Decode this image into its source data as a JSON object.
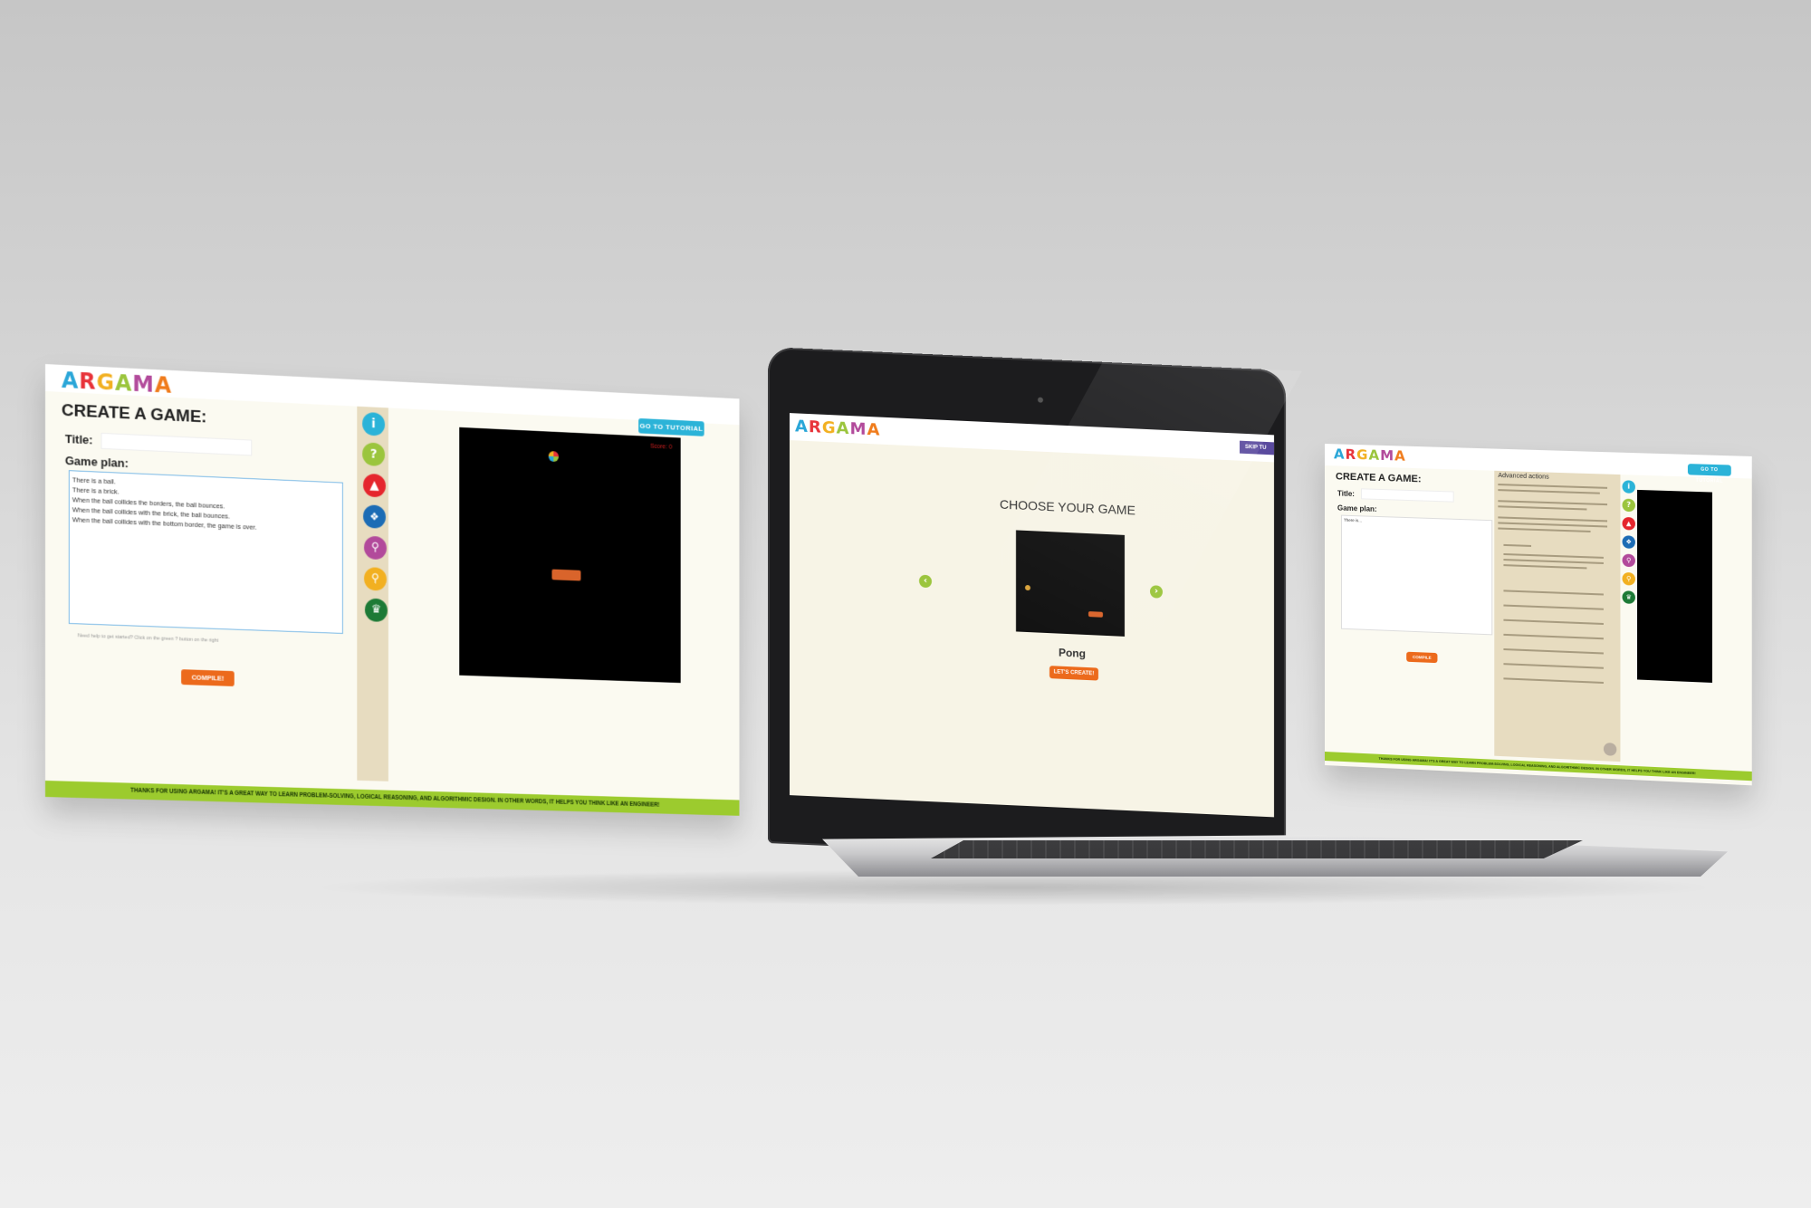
{
  "left_screen": {
    "logo": [
      "A",
      "R",
      "G",
      "A",
      "M",
      "A"
    ],
    "tutorial_button": "GO TO TUTORIAL",
    "heading": "CREATE A GAME:",
    "title_label": "Title:",
    "plan_label": "Game plan:",
    "plan_lines": [
      "There is a ball.",
      "There is a brick.",
      "When the ball collides the borders, the ball bounces.",
      "When the ball collides with the brick, the ball bounces.",
      "When the ball collides with the bottom border, the game is over."
    ],
    "help_text": "Need help to get started? Click on the green ? button on the right",
    "compile_button": "COMPILE!",
    "footer": "THANKS FOR USING ARGAMA! IT'S A GREAT WAY TO LEARN PROBLEM-SOLVING, LOGICAL REASONING, AND ALGORITHMIC DESIGN. IN OTHER WORDS, IT HELPS YOU THINK LIKE AN ENGINEER!",
    "tools": [
      {
        "icon": "info-icon",
        "glyph": "i",
        "color": "#2bb3d8"
      },
      {
        "icon": "help-icon",
        "glyph": "?",
        "color": "#9bc53d"
      },
      {
        "icon": "warning-icon",
        "glyph": "!",
        "color": "#e5262d"
      },
      {
        "icon": "paw-icon",
        "glyph": "●",
        "color": "#1c6cb5"
      },
      {
        "icon": "running-person-icon",
        "glyph": "✦",
        "color": "#b24a9b"
      },
      {
        "icon": "walking-person-icon",
        "glyph": "✦",
        "color": "#f2b021"
      },
      {
        "icon": "trophy-icon",
        "glyph": "♛",
        "color": "#1d7a36"
      }
    ],
    "score_text": "Score: 0"
  },
  "laptop_screen": {
    "logo": [
      "A",
      "R",
      "G",
      "A",
      "M",
      "A"
    ],
    "skip_button": "SKIP TU",
    "heading": "CHOOSE YOUR GAME",
    "game_name": "Pong",
    "create_button": "LET'S CREATE!"
  },
  "right_screen": {
    "logo": [
      "A",
      "R",
      "G",
      "A",
      "M",
      "A"
    ],
    "tutorial_button": "GO TO TUTORIAL",
    "heading": "CREATE A GAME:",
    "title_label": "Title:",
    "plan_label": "Game plan:",
    "plan_placeholder": "There is...",
    "compile_button": "COMPILE",
    "help_panel_title": "Advanced actions",
    "footer": "THANKS FOR USING ARGAMA! IT'S A GREAT WAY TO LEARN PROBLEM-SOLVING, LOGICAL REASONING, AND ALGORITHMIC DESIGN. IN OTHER WORDS, IT HELPS YOU THINK LIKE AN ENGINEER!"
  }
}
